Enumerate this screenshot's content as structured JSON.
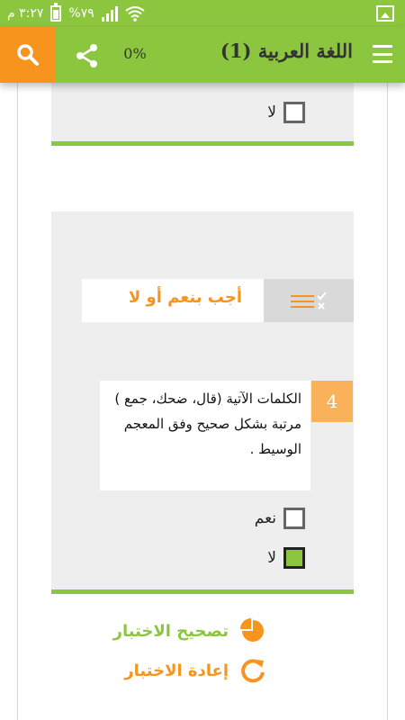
{
  "status_bar": {
    "time": "٣:٢٧ م",
    "battery": "%٧٩"
  },
  "app_bar": {
    "title": "اللغة العربية (1)",
    "progress": "0%"
  },
  "question_prev": {
    "options": [
      {
        "label": "لا",
        "checked": false
      }
    ]
  },
  "question": {
    "instruction": "أجب بنعم أو لا",
    "number": "4",
    "text": "الكلمات الآتية (قال، ضحك، جمع ) مرتبة بشكل صحيح وفق المعجم الوسيط .",
    "options": [
      {
        "label": "نعم",
        "checked": false
      },
      {
        "label": "لا",
        "checked": true
      }
    ]
  },
  "actions": {
    "correct_label": "تصحيح الاختبار",
    "retry_label": "إعادة الاختبار"
  },
  "colors": {
    "primary_green": "#8cc63f",
    "accent_orange": "#f7941d"
  }
}
